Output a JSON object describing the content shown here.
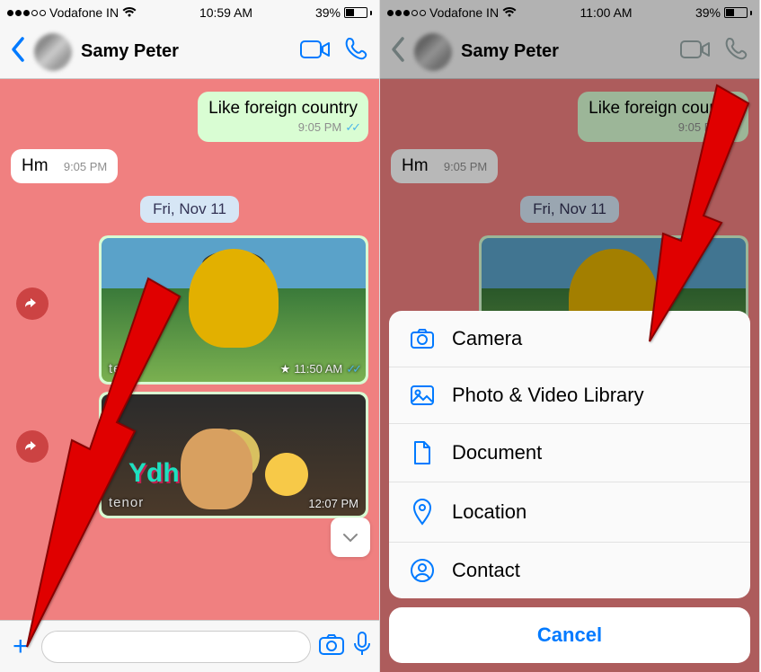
{
  "left": {
    "status": {
      "carrier": "Vodafone IN",
      "time": "10:59 AM",
      "battery_pct": "39%"
    },
    "header": {
      "contact_name": "Samy Peter"
    },
    "chat": {
      "msg_sent1": {
        "text": "Like foreign country",
        "time": "9:05 PM"
      },
      "msg_recv1": {
        "text": "Hm",
        "time": "9:05 PM"
      },
      "date_chip": "Fri, Nov 11",
      "gif1": {
        "label": "GIF",
        "watermark": "tenor",
        "time": "11:50 AM"
      },
      "gif2": {
        "label": "GIF",
        "watermark": "tenor",
        "overlay": "Ydhi",
        "time": "12:07 PM"
      }
    }
  },
  "right": {
    "status": {
      "carrier": "Vodafone IN",
      "time": "11:00 AM",
      "battery_pct": "39%"
    },
    "header": {
      "contact_name": "Samy Peter"
    },
    "chat": {
      "msg_sent1": {
        "text": "Like foreign country",
        "time": "9:05 PM"
      },
      "msg_recv1": {
        "text": "Hm",
        "time": "9:05 PM"
      },
      "date_chip": "Fri, Nov 11"
    },
    "sheet": {
      "camera": "Camera",
      "library": "Photo & Video Library",
      "document": "Document",
      "location": "Location",
      "contact": "Contact",
      "cancel": "Cancel"
    }
  }
}
